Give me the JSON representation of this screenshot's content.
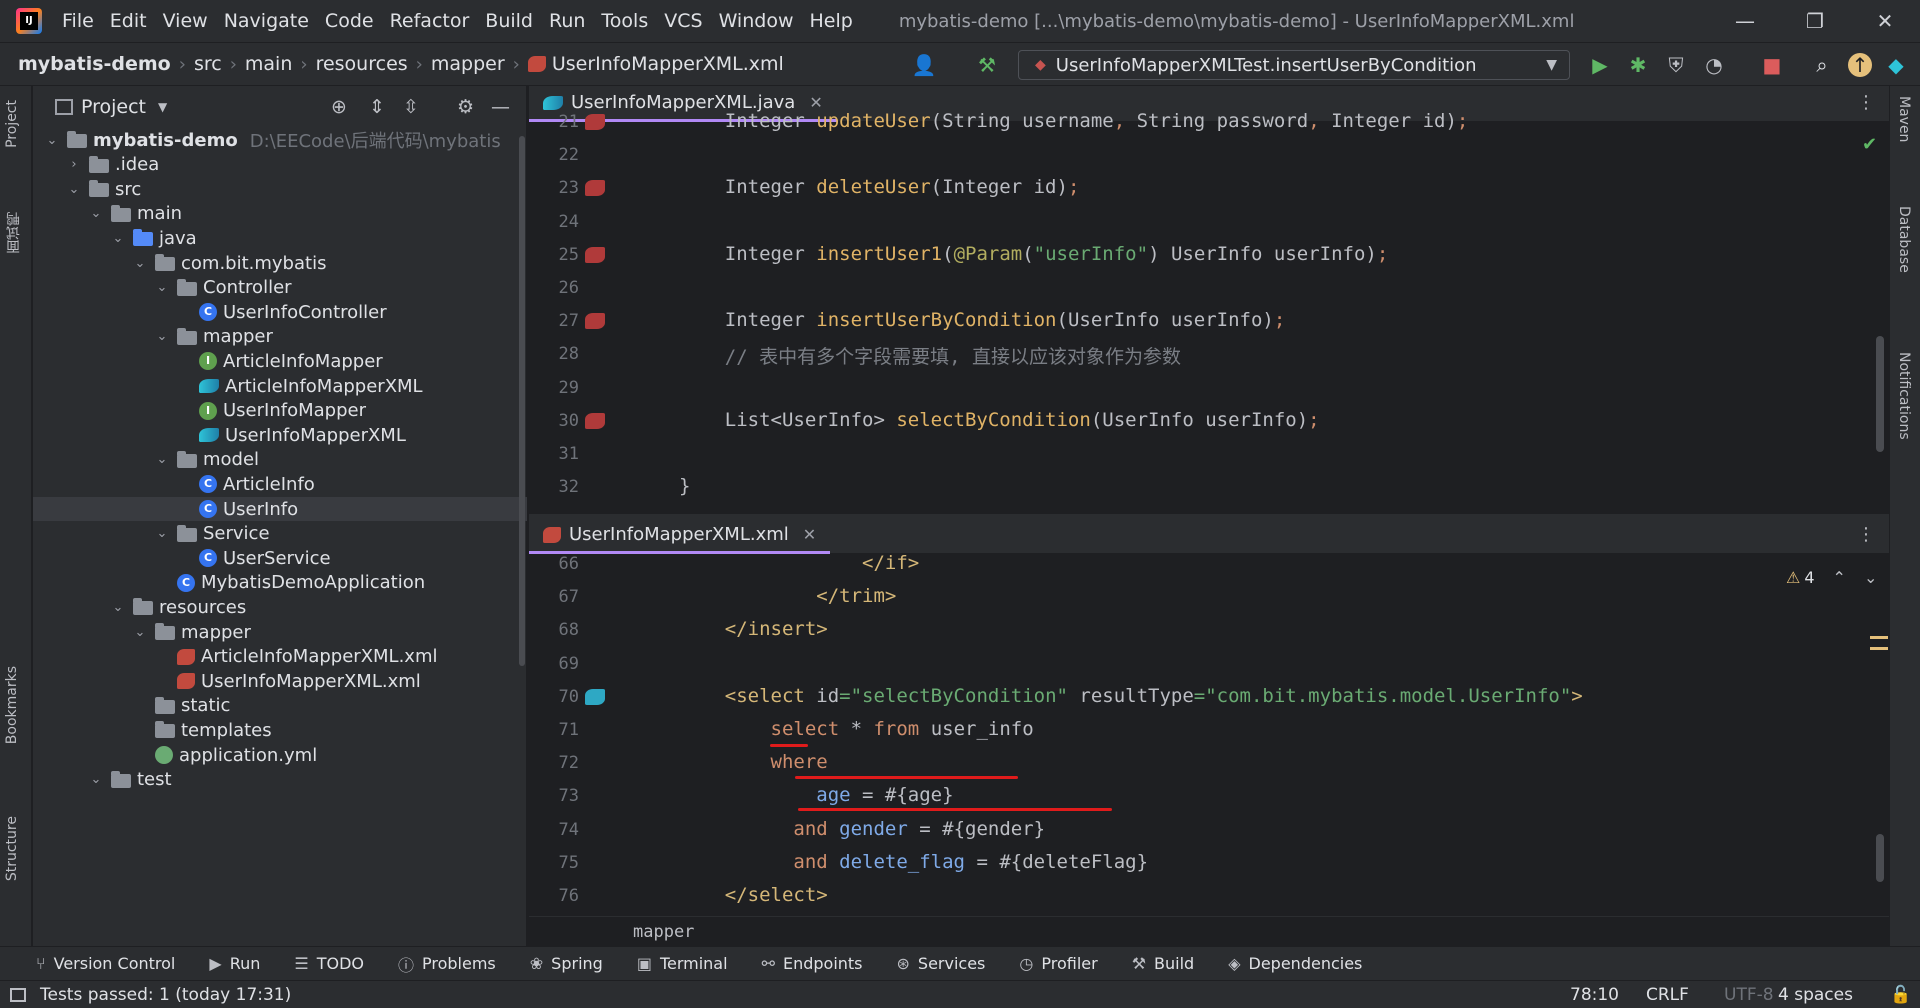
{
  "menu": [
    "File",
    "Edit",
    "View",
    "Navigate",
    "Code",
    "Refactor",
    "Build",
    "Run",
    "Tools",
    "VCS",
    "Window",
    "Help"
  ],
  "window_title": "mybatis-demo [...\\mybatis-demo\\mybatis-demo] - UserInfoMapperXML.xml",
  "breadcrumbs": [
    "mybatis-demo",
    "src",
    "main",
    "resources",
    "mapper",
    "UserInfoMapperXML.xml"
  ],
  "run_config": "UserInfoMapperXMLTest.insertUserByCondition",
  "left_stripe": {
    "project": "Project",
    "cn_label": "面试鸭",
    "bookmarks": "Bookmarks",
    "structure": "Structure"
  },
  "right_stripe": {
    "maven": "Maven",
    "database": "Database",
    "notifications": "Notifications"
  },
  "project_panel": {
    "title": "Project",
    "tree": [
      {
        "label": "mybatis-demo",
        "path": "D:\\EECode\\后端代码\\mybatis",
        "icon": "folder",
        "indent": 0,
        "chev": "v",
        "bold": true
      },
      {
        "label": ".idea",
        "icon": "folder",
        "indent": 1,
        "chev": ">"
      },
      {
        "label": "src",
        "icon": "folder",
        "indent": 1,
        "chev": "v"
      },
      {
        "label": "main",
        "icon": "folder",
        "indent": 2,
        "chev": "v"
      },
      {
        "label": "java",
        "icon": "folder-blue",
        "indent": 3,
        "chev": "v"
      },
      {
        "label": "com.bit.mybatis",
        "icon": "folder",
        "indent": 4,
        "chev": "v"
      },
      {
        "label": "Controller",
        "icon": "folder",
        "indent": 5,
        "chev": "v"
      },
      {
        "label": "UserInfoController",
        "icon": "class",
        "indent": 6,
        "chev": ""
      },
      {
        "label": "mapper",
        "icon": "folder",
        "indent": 5,
        "chev": "v"
      },
      {
        "label": "ArticleInfoMapper",
        "icon": "interface",
        "indent": 6,
        "chev": ""
      },
      {
        "label": "ArticleInfoMapperXML",
        "icon": "bird",
        "indent": 6,
        "chev": ""
      },
      {
        "label": "UserInfoMapper",
        "icon": "interface",
        "indent": 6,
        "chev": ""
      },
      {
        "label": "UserInfoMapperXML",
        "icon": "bird",
        "indent": 6,
        "chev": ""
      },
      {
        "label": "model",
        "icon": "folder",
        "indent": 5,
        "chev": "v"
      },
      {
        "label": "ArticleInfo",
        "icon": "class",
        "indent": 6,
        "chev": ""
      },
      {
        "label": "UserInfo",
        "icon": "class",
        "indent": 6,
        "chev": "",
        "selected": true
      },
      {
        "label": "Service",
        "icon": "folder",
        "indent": 5,
        "chev": "v"
      },
      {
        "label": "UserService",
        "icon": "class",
        "indent": 6,
        "chev": ""
      },
      {
        "label": "MybatisDemoApplication",
        "icon": "class",
        "indent": 5,
        "chev": ""
      },
      {
        "label": "resources",
        "icon": "folder",
        "indent": 3,
        "chev": "v"
      },
      {
        "label": "mapper",
        "icon": "folder",
        "indent": 4,
        "chev": "v"
      },
      {
        "label": "ArticleInfoMapperXML.xml",
        "icon": "xml",
        "indent": 5,
        "chev": ""
      },
      {
        "label": "UserInfoMapperXML.xml",
        "icon": "xml",
        "indent": 5,
        "chev": ""
      },
      {
        "label": "static",
        "icon": "folder",
        "indent": 4,
        "chev": ""
      },
      {
        "label": "templates",
        "icon": "folder",
        "indent": 4,
        "chev": ""
      },
      {
        "label": "application.yml",
        "icon": "yml",
        "indent": 4,
        "chev": ""
      },
      {
        "label": "test",
        "icon": "folder",
        "indent": 2,
        "chev": "v"
      }
    ]
  },
  "editor_top": {
    "tab": "UserInfoMapperXML.java",
    "lines": [
      {
        "n": "21",
        "html": "    Integer <span class=\"mth\">updateUser</span>(String username<span class=\"kw\">,</span> String password<span class=\"kw\">,</span> Integer id)<span class=\"kw\">;</span>",
        "mark": true
      },
      {
        "n": "22",
        "html": ""
      },
      {
        "n": "23",
        "html": "    Integer <span class=\"mth\">deleteUser</span>(Integer id)<span class=\"kw\">;</span>",
        "mark": true
      },
      {
        "n": "24",
        "html": ""
      },
      {
        "n": "25",
        "html": "    Integer <span class=\"mth\">insertUser1</span>(<span class=\"ann\">@Param</span>(<span class=\"str\">\"userInfo\"</span>) UserInfo userInfo)<span class=\"kw\">;</span>",
        "mark": true
      },
      {
        "n": "26",
        "html": ""
      },
      {
        "n": "27",
        "html": "    Integer <span class=\"mth\">insertUserByCondition</span>(UserInfo userInfo)<span class=\"kw\">;</span>",
        "mark": true
      },
      {
        "n": "28",
        "html": "    <span class=\"cm\">// 表中有多个字段需要填, 直接以应该对象作为参数</span>"
      },
      {
        "n": "29",
        "html": ""
      },
      {
        "n": "30",
        "html": "    List&lt;UserInfo&gt; <span class=\"mth\">selectByCondition</span>(UserInfo userInfo)<span class=\"kw\">;</span>",
        "mark": true
      },
      {
        "n": "31",
        "html": ""
      },
      {
        "n": "32",
        "html": "}"
      }
    ]
  },
  "editor_bottom": {
    "tab": "UserInfoMapperXML.xml",
    "warnings": "4",
    "breadcrumb": "mapper",
    "lines": [
      {
        "n": "66",
        "html": "                <span class=\"tag\">&lt;/if&gt;</span>"
      },
      {
        "n": "67",
        "html": "            <span class=\"tag\">&lt;/trim&gt;</span>"
      },
      {
        "n": "68",
        "html": "    <span class=\"tag\">&lt;/insert&gt;</span>"
      },
      {
        "n": "69",
        "html": ""
      },
      {
        "n": "70",
        "html": "    <span class=\"tag\">&lt;select </span><span class=\"attr\">id</span><span class=\"str\">=\"selectByCondition\"</span> <span class=\"attr\">resultType</span><span class=\"str\">=\"com.bit.mybatis.model.UserInfo\"</span><span class=\"tag\">&gt;</span>",
        "mark": true
      },
      {
        "n": "71",
        "html": "        <span class=\"kw\">select</span> * <span class=\"kw\">from</span> user_info"
      },
      {
        "n": "72",
        "html": "        <span class=\"kw\">where</span>"
      },
      {
        "n": "73",
        "html": "            <span class=\"field\">age</span> = #{age}"
      },
      {
        "n": "74",
        "html": "          <span class=\"kw\">and</span> <span class=\"field\">gender</span> = #{gender}"
      },
      {
        "n": "75",
        "html": "          <span class=\"kw\">and</span> <span class=\"field\">delete_flag</span> = #{deleteFlag}"
      },
      {
        "n": "76",
        "html": "    <span class=\"tag\">&lt;/select&gt;</span>"
      }
    ]
  },
  "tool_strip": [
    "Version Control",
    "Run",
    "TODO",
    "Problems",
    "Spring",
    "Terminal",
    "Endpoints",
    "Services",
    "Profiler",
    "Build",
    "Dependencies"
  ],
  "status": {
    "message": "Tests passed: 1 (today 17:31)",
    "position": "78:10",
    "line_sep": "CRLF",
    "encoding": "UTF-8",
    "indent": "4 spaces"
  }
}
